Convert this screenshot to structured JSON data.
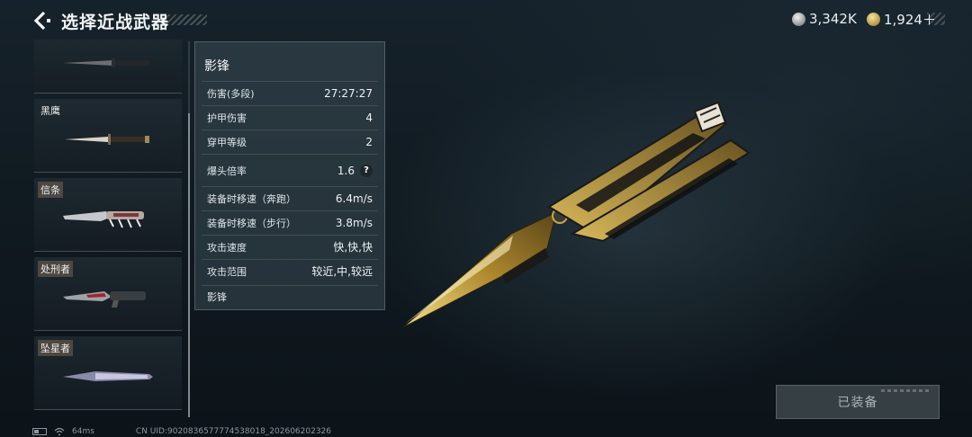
{
  "header": {
    "title": "选择近战武器",
    "currencies": [
      {
        "icon": "silver-coin-icon",
        "value": "3,342K"
      },
      {
        "icon": "gold-coin-icon",
        "value": "1,924＋"
      }
    ]
  },
  "weapon_list": {
    "items": [
      {
        "name": ""
      },
      {
        "name": "黑鹰"
      },
      {
        "name": "信条"
      },
      {
        "name": "处刑者"
      },
      {
        "name": "坠星者"
      }
    ]
  },
  "stats": {
    "weapon_name": "影锋",
    "rows": [
      {
        "label": "伤害(多段)",
        "value": "27:27:27"
      },
      {
        "label": "护甲伤害",
        "value": "4"
      },
      {
        "label": "穿甲等级",
        "value": "2"
      },
      {
        "label": "爆头倍率",
        "value": "1.6"
      },
      {
        "label": "装备时移速（奔跑）",
        "value": "6.4m/s"
      },
      {
        "label": "装备时移速（步行）",
        "value": "3.8m/s"
      },
      {
        "label": "攻击速度",
        "value": "快,快,快"
      },
      {
        "label": "攻击范围",
        "value": "较近,中,较远"
      }
    ],
    "help_glyph": "?",
    "footer": "影锋"
  },
  "equip_button": {
    "label": "已装备"
  },
  "status_bar": {
    "ping": "64ms",
    "uid": "CN UID:9020836577774538018_202606202326"
  },
  "colors": {
    "background": "#101a21",
    "panel": "#3a4a54",
    "gold_accent": "#c9a84a"
  }
}
